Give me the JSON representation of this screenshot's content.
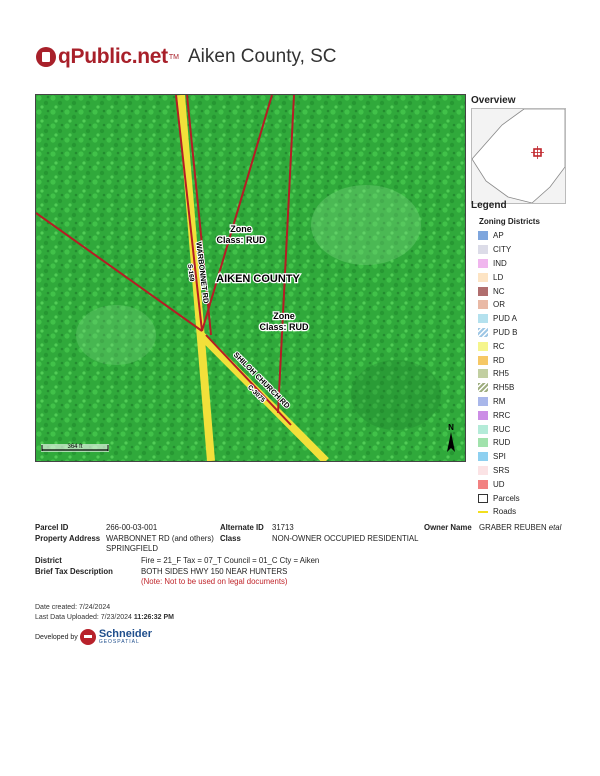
{
  "header": {
    "logo_text": "qPublic.net",
    "logo_tm": "TM",
    "county": "Aiken County, SC"
  },
  "map": {
    "labels": {
      "zone_1_line1": "Zone",
      "zone_1_line2": "Class: RUD",
      "zone_2_line1": "Zone",
      "zone_2_line2": "Class: RUD",
      "aiken_county": "AIKEN COUNTY",
      "road_warbonnet": "WARBONNET RD",
      "road_warbonnet_code": "S-169",
      "road_shiloh": "SHILOH CHURCH RD",
      "road_shiloh_code": "C-3075",
      "scale_label": "364 ft",
      "north_label": "N"
    },
    "colors": {
      "vegetation": "#2fae3a",
      "road": "#f3e234",
      "parcel_line": "#b51d24"
    }
  },
  "overview": {
    "title": "Overview"
  },
  "legend": {
    "title": "Legend",
    "subtitle": "Zoning Districts",
    "items": [
      {
        "label": "AP",
        "color": "#7ea6dd",
        "pattern": "solid"
      },
      {
        "label": "CITY",
        "color": "#dcdce8",
        "pattern": "solid"
      },
      {
        "label": "IND",
        "color": "#f0b6ee",
        "pattern": "solid"
      },
      {
        "label": "LD",
        "color": "#fde4c4",
        "pattern": "solid"
      },
      {
        "label": "NC",
        "color": "#b06e6e",
        "pattern": "solid"
      },
      {
        "label": "OR",
        "color": "#e9b9a5",
        "pattern": "solid"
      },
      {
        "label": "PUD A",
        "color": "#b4e1ee",
        "pattern": "solid"
      },
      {
        "label": "PUD B",
        "color": "#9fc7e5",
        "pattern": "hatch"
      },
      {
        "label": "RC",
        "color": "#f5f58c",
        "pattern": "solid"
      },
      {
        "label": "RD",
        "color": "#f6c865",
        "pattern": "solid"
      },
      {
        "label": "RH5",
        "color": "#c2cfa1",
        "pattern": "solid"
      },
      {
        "label": "RH5B",
        "color": "#9fae80",
        "pattern": "hatch"
      },
      {
        "label": "RM",
        "color": "#a9b7ea",
        "pattern": "solid"
      },
      {
        "label": "RRC",
        "color": "#cc8ee6",
        "pattern": "solid"
      },
      {
        "label": "RUC",
        "color": "#b4ebd8",
        "pattern": "solid"
      },
      {
        "label": "RUD",
        "color": "#a1e2ac",
        "pattern": "solid"
      },
      {
        "label": "SPI",
        "color": "#8ed0f0",
        "pattern": "solid"
      },
      {
        "label": "SRS",
        "color": "#fbe3e5",
        "pattern": "solid"
      },
      {
        "label": "UD",
        "color": "#f28181",
        "pattern": "solid"
      },
      {
        "label": "Parcels",
        "color": "#ffffff",
        "pattern": "outline"
      },
      {
        "label": "Roads",
        "color": "#f2df1e",
        "pattern": "line"
      }
    ]
  },
  "parcel": {
    "parcel_id_label": "Parcel ID",
    "parcel_id": "266-00-03-001",
    "alternate_id_label": "Alternate ID",
    "alternate_id": "31713",
    "owner_name_label": "Owner Name",
    "owner_name": "GRABER REUBEN",
    "owner_suffix": "etal",
    "property_address_label": "Property Address",
    "property_address_line1": "WARBONNET RD (and others)",
    "property_address_line2": "SPRINGFIELD",
    "class_label": "Class",
    "class_value": "NON-OWNER OCCUPIED RESIDENTIAL",
    "district_label": "District",
    "district_value": "Fire = 21_F Tax = 07_T Council = 01_C Cty = Aiken",
    "tax_desc_label": "Brief Tax Description",
    "tax_desc_value": "BOTH SIDES HWY 150 NEAR HUNTERS",
    "tax_note": "(Note: Not to be used on legal documents)"
  },
  "footer": {
    "date_created_label": "Date created:",
    "date_created": "7/24/2024",
    "last_upload_label": "Last Data Uploaded:",
    "last_upload_date": "7/23/2024",
    "last_upload_time": "11:26:32 PM",
    "developed_by": "Developed by",
    "company_name": "Schneider",
    "company_sub": "GEOSPATIAL"
  }
}
